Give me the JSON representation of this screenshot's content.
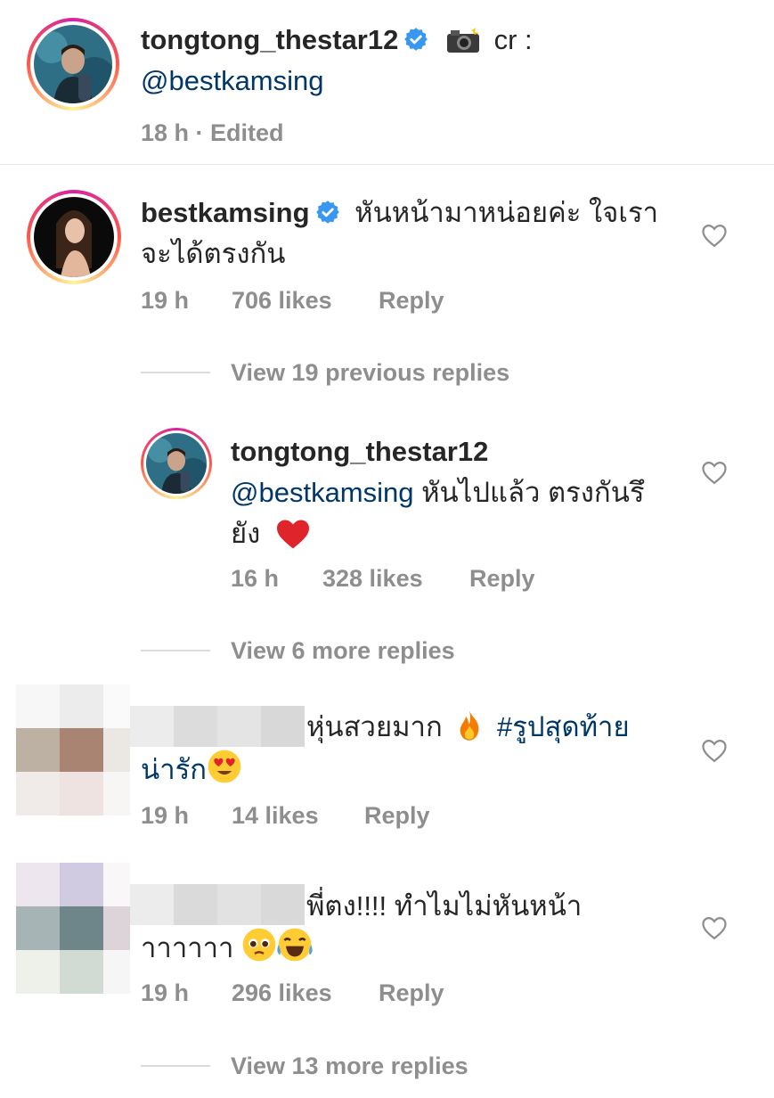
{
  "post": {
    "username": "tongtong_thestar12",
    "caption_suffix": "cr :",
    "caption_mention": "@bestkamsing",
    "meta": "18 h · Edited",
    "camera_icon": "camera-flash-emoji"
  },
  "comments": [
    {
      "username": "bestkamsing",
      "text_line1": "หันหน้ามาหน่อยค่ะ ใจเรา",
      "text_line2": "จะได้ตรงกัน",
      "time": "19 h",
      "likes": "706 likes",
      "reply": "Reply",
      "view_replies": "View 19 previous replies"
    },
    {
      "username": "tongtong_thestar12",
      "mention": "@bestkamsing",
      "text_line1": " หันไปแล้ว ตรงกันรึ",
      "text_line2": "ยัง",
      "time": "16 h",
      "likes": "328 likes",
      "reply": "Reply",
      "view_replies": "View 6 more replies"
    },
    {
      "text_line1": "หุ่นสวยมาก",
      "hashtag": "#รูปสุดท้าย",
      "hashtag_line2": "น่ารัก",
      "time": "19 h",
      "likes": "14 likes",
      "reply": "Reply"
    },
    {
      "text_line1": "พี่ตง!!!! ทำไมไม่หันหน้า",
      "text_line2": "าาาาาา",
      "time": "19 h",
      "likes": "296 likes",
      "reply": "Reply",
      "view_replies": "View 13 more replies"
    }
  ],
  "colors": {
    "text": "#262626",
    "meta": "#8e8e8e",
    "mention": "#00376b",
    "verified": "#3897f0",
    "heart_red": "#e0242b"
  }
}
